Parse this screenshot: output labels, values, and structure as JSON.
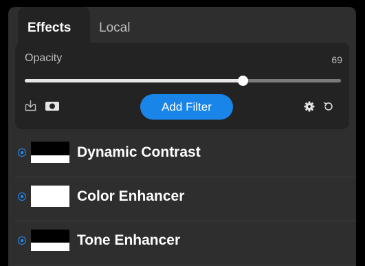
{
  "tabs": {
    "effects": "Effects",
    "local": "Local"
  },
  "controls": {
    "opacity_label": "Opacity",
    "opacity_value": "69",
    "opacity_fraction": 0.69,
    "add_filter_label": "Add Filter",
    "icons": [
      "save-preset-icon",
      "mask-icon",
      "gear-icon",
      "undo-icon"
    ]
  },
  "filters": [
    {
      "name": "Dynamic Contrast",
      "enabled": true
    },
    {
      "name": "Color Enhancer",
      "enabled": true
    },
    {
      "name": "Tone Enhancer",
      "enabled": true
    }
  ],
  "colors": {
    "accent": "#1a85e8",
    "panel_bg": "#2e2e2e",
    "controls_bg": "#232323"
  }
}
